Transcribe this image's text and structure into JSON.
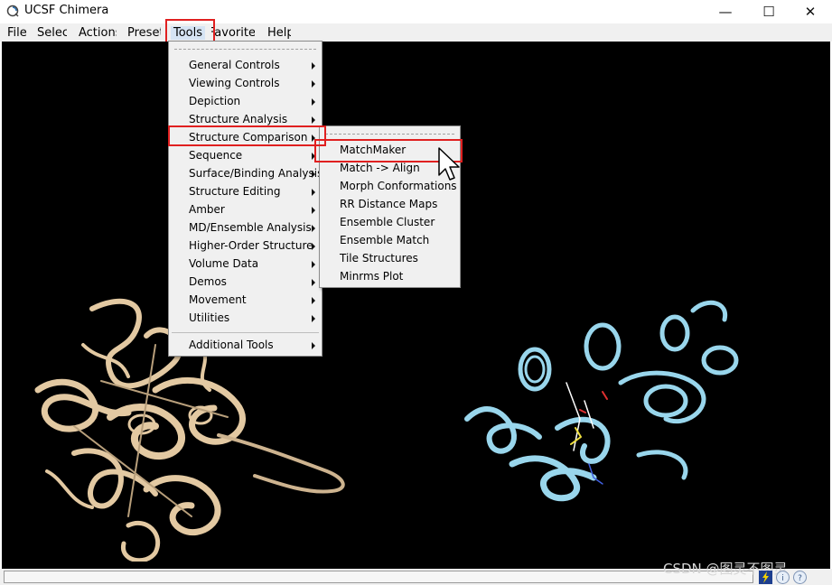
{
  "window": {
    "title": "UCSF Chimera",
    "minimize": "—",
    "maximize": "☐",
    "close": "✕"
  },
  "menubar": {
    "items": [
      {
        "label": "File"
      },
      {
        "label": "Select"
      },
      {
        "label": "Actions"
      },
      {
        "label": "Presets"
      },
      {
        "label": "Tools"
      },
      {
        "label": "Favorites"
      },
      {
        "label": "Help"
      }
    ]
  },
  "tools_menu": {
    "items": [
      {
        "label": "General Controls",
        "submenu": true
      },
      {
        "label": "Viewing Controls",
        "submenu": true
      },
      {
        "label": "Depiction",
        "submenu": true
      },
      {
        "label": "Structure Analysis",
        "submenu": true
      },
      {
        "label": "Structure Comparison",
        "submenu": true
      },
      {
        "label": "Sequence",
        "submenu": true
      },
      {
        "label": "Surface/Binding Analysis",
        "submenu": true
      },
      {
        "label": "Structure Editing",
        "submenu": true
      },
      {
        "label": "Amber",
        "submenu": true
      },
      {
        "label": "MD/Ensemble Analysis",
        "submenu": true
      },
      {
        "label": "Higher-Order Structure",
        "submenu": true
      },
      {
        "label": "Volume Data",
        "submenu": true
      },
      {
        "label": "Demos",
        "submenu": true
      },
      {
        "label": "Movement",
        "submenu": true
      },
      {
        "label": "Utilities",
        "submenu": true
      },
      {
        "label": "Additional Tools",
        "submenu": true
      }
    ]
  },
  "structure_comparison_menu": {
    "items": [
      {
        "label": "MatchMaker"
      },
      {
        "label": "Match -> Align"
      },
      {
        "label": "Morph Conformations"
      },
      {
        "label": "RR Distance Maps"
      },
      {
        "label": "Ensemble Cluster"
      },
      {
        "label": "Ensemble Match"
      },
      {
        "label": "Tile Structures"
      },
      {
        "label": "Minrms Plot"
      }
    ]
  },
  "viewport": {
    "background": "#000000",
    "models": [
      {
        "color": "#e3c9a2"
      },
      {
        "color": "#99d6ec"
      }
    ]
  },
  "watermark": "CSDN @图灵不图灵",
  "colors": {
    "highlight_box": "#e02020",
    "menu_bg": "#f0f0f0"
  }
}
